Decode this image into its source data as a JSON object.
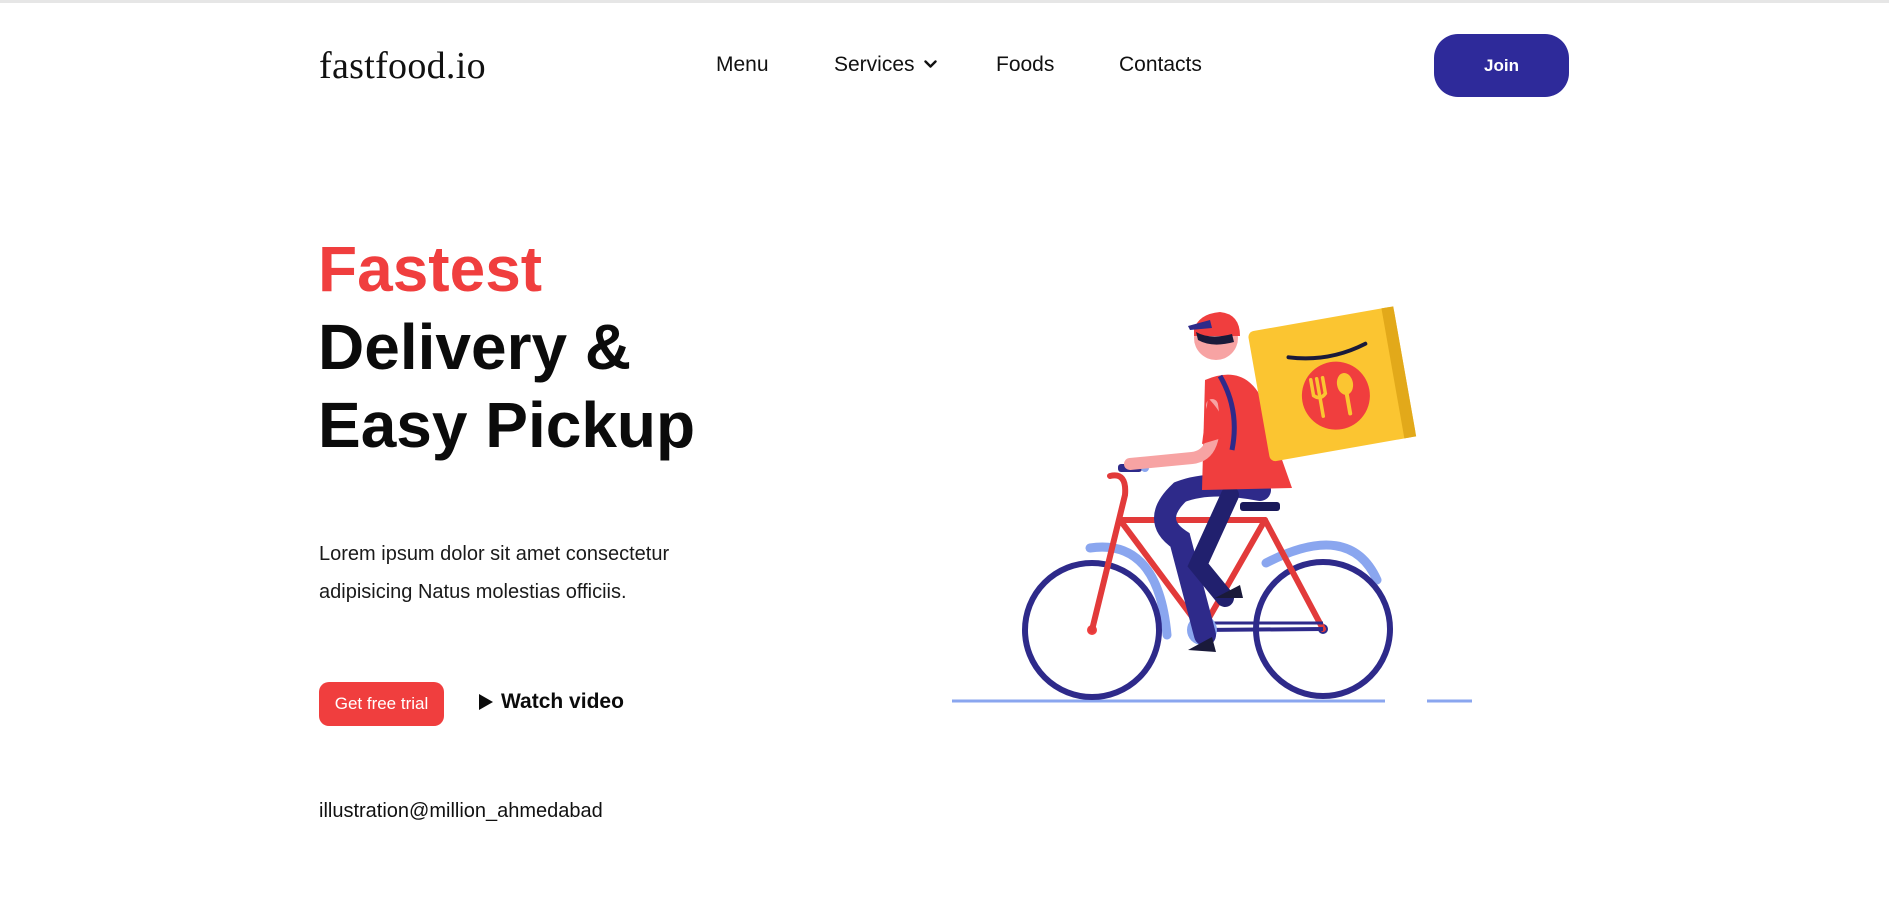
{
  "brand": {
    "logo_text": "fastfood.io"
  },
  "nav": {
    "items": [
      {
        "label": "Menu"
      },
      {
        "label": "Services",
        "has_dropdown": true
      },
      {
        "label": "Foods"
      },
      {
        "label": "Contacts"
      }
    ],
    "join_label": "Join"
  },
  "hero": {
    "title_accent": "Fastest",
    "title_line_1": "Delivery &",
    "title_line_2": "Easy Pickup",
    "description": "Lorem ipsum dolor sit amet consectetur adipisicing Natus molestias officiis.",
    "cta_label": "Get free trial",
    "watch_label": "Watch video",
    "credit": "illustration@million_ahmedabad"
  },
  "icons": {
    "dropdown": "chevron-down-icon",
    "play": "play-icon",
    "illustration": "delivery-cyclist-illustration"
  },
  "colors": {
    "accent_red": "#f03e3e",
    "brand_navy": "#2e2a9a",
    "text_dark": "#0b0b0b",
    "box_yellow": "#fbc531",
    "light_blue": "#8aa6ef"
  }
}
